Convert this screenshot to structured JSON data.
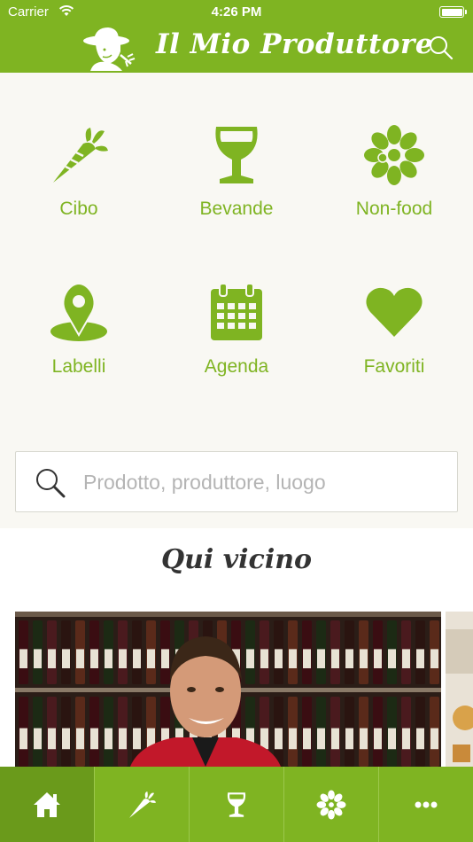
{
  "status_bar": {
    "carrier": "Carrier",
    "time": "4:26 PM"
  },
  "header": {
    "title": "Il Mio Produttore",
    "logo_icon": "farmer-logo-icon",
    "search_icon": "search-icon"
  },
  "categories": [
    {
      "label": "Cibo",
      "icon": "carrot-icon"
    },
    {
      "label": "Bevande",
      "icon": "wine-glass-icon"
    },
    {
      "label": "Non-food",
      "icon": "flower-icon"
    },
    {
      "label": "Labelli",
      "icon": "map-pin-icon"
    },
    {
      "label": "Agenda",
      "icon": "calendar-icon"
    },
    {
      "label": "Favoriti",
      "icon": "heart-icon"
    }
  ],
  "search": {
    "placeholder": "Prodotto, produttore, luogo"
  },
  "nearby": {
    "title": "Qui vicino"
  },
  "tabbar": {
    "items": [
      {
        "icon": "home-icon",
        "active": true
      },
      {
        "icon": "carrot-icon",
        "active": false
      },
      {
        "icon": "wine-glass-icon",
        "active": false
      },
      {
        "icon": "flower-icon",
        "active": false
      },
      {
        "icon": "more-icon",
        "active": false
      }
    ]
  },
  "colors": {
    "brand_green": "#7fb422",
    "active_tab": "#6a9a1b",
    "category_bg": "#f9f8f3"
  }
}
